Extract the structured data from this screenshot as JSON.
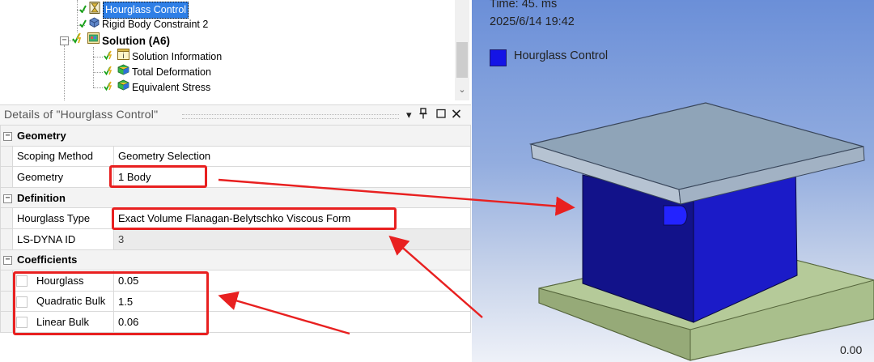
{
  "tree": {
    "items": [
      {
        "label": "Hourglass Control",
        "selected": true,
        "icon": "hourglass-icon"
      },
      {
        "label": "Rigid Body Constraint 2",
        "icon": "rigid-body-constraint-icon"
      },
      {
        "label": "Solution (A6)",
        "bold": true,
        "icon": "solution-icon"
      },
      {
        "label": "Solution Information",
        "icon": "solution-information-icon"
      },
      {
        "label": "Total Deformation",
        "icon": "total-deformation-icon"
      },
      {
        "label": "Equivalent Stress",
        "icon": "equivalent-stress-icon"
      }
    ],
    "scroll_down_glyph": "⌄"
  },
  "details": {
    "title": "Details of \"Hourglass Control\"",
    "buttons": {
      "menu": "▾",
      "pin": "ᛘ",
      "restore": "□",
      "close": "✕"
    },
    "sections": [
      {
        "name": "Geometry",
        "rows": [
          {
            "label": "Scoping Method",
            "value": "Geometry Selection"
          },
          {
            "label": "Geometry",
            "value": "1 Body"
          }
        ]
      },
      {
        "name": "Definition",
        "rows": [
          {
            "label": "Hourglass Type",
            "value": "Exact Volume Flanagan-Belytschko Viscous Form"
          },
          {
            "label": "LS-DYNA ID",
            "value": "3"
          }
        ]
      },
      {
        "name": "Coefficients",
        "rows": [
          {
            "label": "Hourglass",
            "value": "0.05"
          },
          {
            "label": "Quadratic Bulk",
            "value": "1.5"
          },
          {
            "label": "Linear Bulk",
            "value": "0.06"
          }
        ]
      }
    ]
  },
  "viewport": {
    "time_text": "Time: 45. ms",
    "date_text": "2025/6/14 19:42",
    "legend_label": "Hourglass Control",
    "legend_color": "#1414e6",
    "scale_value": "0.00"
  },
  "colors": {
    "selection": "#2f7fe6",
    "annotation_red": "#e82020",
    "top_plate": "#8fa4b8",
    "body_front": "#12128a",
    "body_side": "#1b1bc8",
    "base_plate": "#a9bf8c"
  }
}
